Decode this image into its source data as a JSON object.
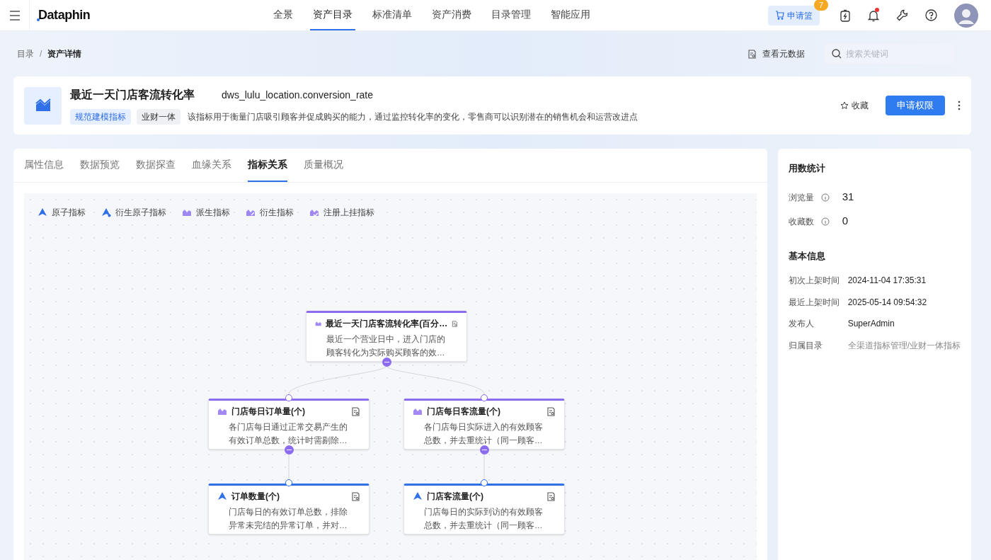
{
  "topbar": {
    "logo": "Dataphin",
    "nav": [
      {
        "label": "全景",
        "selected": false
      },
      {
        "label": "资产目录",
        "selected": true
      },
      {
        "label": "标准清单",
        "selected": false
      },
      {
        "label": "资产消费",
        "selected": false
      },
      {
        "label": "目录管理",
        "selected": false
      },
      {
        "label": "智能应用",
        "selected": false
      }
    ],
    "cart": {
      "label": "申请篮",
      "count": "7"
    },
    "notification_dot": true
  },
  "breadcrumb": [
    {
      "label": "目录"
    },
    {
      "label": "资产详情"
    }
  ],
  "breadcrumb_separator": "/",
  "metadata_link": "查看元数据",
  "search": {
    "placeholder": "搜索关键词"
  },
  "asset": {
    "title": "最近一天门店客流转化率",
    "code": "dws_lulu_location.conversion_rate",
    "tags": [
      {
        "label": "规范建模指标",
        "kind": "primary"
      },
      {
        "label": "业财一体",
        "kind": "plain"
      }
    ],
    "description": "该指标用于衡量门店吸引顾客并促成购买的能力，通过监控转化率的变化，零售商可以识别潜在的销售机会和运营改进点",
    "favorite": {
      "label": "收藏",
      "on": false
    },
    "apply_button": "申请权限"
  },
  "tabs": [
    {
      "label": "属性信息",
      "selected": false
    },
    {
      "label": "数据预览",
      "selected": false
    },
    {
      "label": "数据探查",
      "selected": false
    },
    {
      "label": "血缘关系",
      "selected": false
    },
    {
      "label": "指标关系",
      "selected": true
    },
    {
      "label": "质量概况",
      "selected": false
    }
  ],
  "legend": [
    {
      "label": "原子指标",
      "kind": "atomic"
    },
    {
      "label": "衍生原子指标",
      "kind": "derived-atomic"
    },
    {
      "label": "派生指标",
      "kind": "derivative"
    },
    {
      "label": "衍生指标",
      "kind": "derived"
    },
    {
      "label": "注册上挂指标",
      "kind": "registered"
    }
  ],
  "graph": {
    "root": {
      "kind": "derivative",
      "title": "最近一天门店客流转化率(百分…",
      "description": "最近一个营业日中，进入门店的顾客转化为实际购买顾客的效…",
      "expanded": true,
      "children": [
        {
          "kind": "derivative",
          "title": "门店每日订单量(个)",
          "description": "各门店每日通过正常交易产生的有效订单总数，统计时需剔除…",
          "expanded": true,
          "children": [
            {
              "kind": "atomic",
              "title": "订单数量(个)",
              "description": "门店每日的有效订单总数，排除异常未完结的异常订单，并对…"
            }
          ]
        },
        {
          "kind": "derivative",
          "title": "门店每日客流量(个)",
          "description": "各门店每日实际进入的有效顾客总数，并去重统计（同一顾客…",
          "expanded": true,
          "children": [
            {
              "kind": "atomic",
              "title": "门店客流量(个)",
              "description": "门店每日的实际到访的有效顾客总数，并去重统计（同一顾客…"
            }
          ]
        }
      ]
    }
  },
  "usage_stats": {
    "title": "用数统计",
    "items": [
      {
        "label": "浏览量",
        "value": "31"
      },
      {
        "label": "收藏数",
        "value": "0"
      }
    ]
  },
  "basic_info": {
    "title": "基本信息",
    "items": [
      {
        "label": "初次上架时间",
        "value": "2024-11-04 17:35:31",
        "kind": "text"
      },
      {
        "label": "最近上架时间",
        "value": "2025-05-14 09:54:32",
        "kind": "text"
      },
      {
        "label": "发布人",
        "value": "SuperAdmin",
        "kind": "text"
      },
      {
        "label": "归属目录",
        "value": "全渠道指标管理/业财一体指标",
        "kind": "muted"
      }
    ]
  }
}
